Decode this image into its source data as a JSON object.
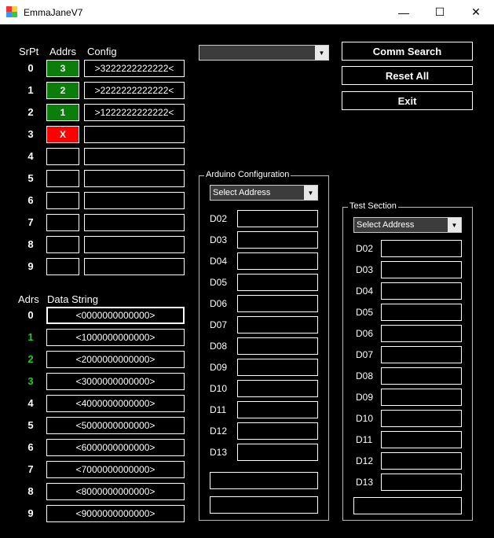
{
  "window": {
    "title": "EmmaJaneV7",
    "minimize": "—",
    "maximize": "☐",
    "close": "✕"
  },
  "serial": {
    "headers": {
      "srpt": "SrPt",
      "addrs": "Addrs",
      "config": "Config"
    },
    "rows": [
      {
        "srpt": "0",
        "addr": "3",
        "status": "ok",
        "config": ">3222222222222<"
      },
      {
        "srpt": "1",
        "addr": "2",
        "status": "ok",
        "config": ">2222222222222<"
      },
      {
        "srpt": "2",
        "addr": "1",
        "status": "ok",
        "config": ">1222222222222<"
      },
      {
        "srpt": "3",
        "addr": "X",
        "status": "error",
        "config": ""
      },
      {
        "srpt": "4",
        "addr": "",
        "status": "empty",
        "config": ""
      },
      {
        "srpt": "5",
        "addr": "",
        "status": "empty",
        "config": ""
      },
      {
        "srpt": "6",
        "addr": "",
        "status": "empty",
        "config": ""
      },
      {
        "srpt": "7",
        "addr": "",
        "status": "empty",
        "config": ""
      },
      {
        "srpt": "8",
        "addr": "",
        "status": "empty",
        "config": ""
      },
      {
        "srpt": "9",
        "addr": "",
        "status": "empty",
        "config": ""
      }
    ]
  },
  "data": {
    "headers": {
      "adrs": "Adrs",
      "string": "Data String"
    },
    "rows": [
      {
        "adrs": "0",
        "value": "<0000000000000>",
        "active": false
      },
      {
        "adrs": "1",
        "value": "<1000000000000>",
        "active": true
      },
      {
        "adrs": "2",
        "value": "<2000000000000>",
        "active": true
      },
      {
        "adrs": "3",
        "value": "<3000000000000>",
        "active": true
      },
      {
        "adrs": "4",
        "value": "<4000000000000>",
        "active": false
      },
      {
        "adrs": "5",
        "value": "<5000000000000>",
        "active": false
      },
      {
        "adrs": "6",
        "value": "<6000000000000>",
        "active": false
      },
      {
        "adrs": "7",
        "value": "<7000000000000>",
        "active": false
      },
      {
        "adrs": "8",
        "value": "<8000000000000>",
        "active": false
      },
      {
        "adrs": "9",
        "value": "<9000000000000>",
        "active": false
      }
    ]
  },
  "port_select": {
    "value": ""
  },
  "buttons": {
    "comm_search": "Comm Search",
    "reset_all": "Reset All",
    "exit": "Exit"
  },
  "arduino": {
    "title": "Arduino Configuration",
    "select": "Select Address",
    "pins": [
      "D02",
      "D03",
      "D04",
      "D05",
      "D06",
      "D07",
      "D08",
      "D09",
      "D10",
      "D11",
      "D12",
      "D13"
    ]
  },
  "test": {
    "title": "Test Section",
    "select": "Select Address",
    "pins": [
      "D02",
      "D03",
      "D04",
      "D05",
      "D06",
      "D07",
      "D08",
      "D09",
      "D10",
      "D11",
      "D12",
      "D13"
    ]
  },
  "colors": {
    "ok": "#0a7d0a",
    "error": "#ff0000",
    "active_label": "#22cc22"
  }
}
